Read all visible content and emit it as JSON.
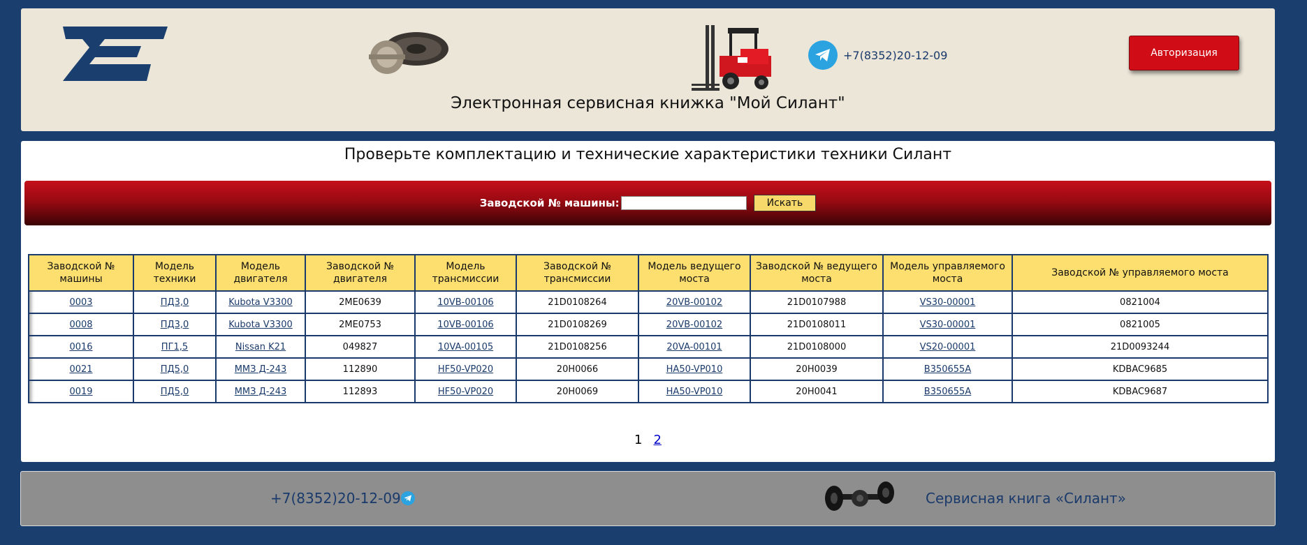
{
  "header": {
    "phone": "+7(8352)20-12-09",
    "auth_label": "Авторизация",
    "title": "Электронная сервисная книжка \"Мой Силант\""
  },
  "main": {
    "title": "Проверьте комплектацию и технические характеристики техники Силант",
    "search_label": "Заводской № машины:",
    "search_value": "",
    "search_button": "Искать"
  },
  "table": {
    "columns": [
      "Заводской № машины",
      "Модель техники",
      "Модель двигателя",
      "Заводской № двигателя",
      "Модель трансмиссии",
      "Заводской № трансмиссии",
      "Модель ведущего моста",
      "Заводской № ведущего моста",
      "Модель управляемого моста",
      "Заводской № управляемого моста"
    ],
    "rows": [
      [
        "0003",
        "ПД3,0",
        "Kubota V3300",
        "2ME0639",
        "10VB-00106",
        "21D0108264",
        "20VB-00102",
        "21D0107988",
        "VS30-00001",
        "0821004"
      ],
      [
        "0008",
        "ПД3,0",
        "Kubota V3300",
        "2ME0753",
        "10VB-00106",
        "21D0108269",
        "20VB-00102",
        "21D0108011",
        "VS30-00001",
        "0821005"
      ],
      [
        "0016",
        "ПГ1,5",
        "Nissan K21",
        "049827",
        "10VA-00105",
        "21D0108256",
        "20VA-00101",
        "21D0108000",
        "VS20-00001",
        "21D0093244"
      ],
      [
        "0021",
        "ПД5,0",
        "ММЗ Д-243",
        "112890",
        "HF50-VP020",
        "20H0066",
        "HA50-VP010",
        "20H0039",
        "B350655A",
        "KDBAC9685"
      ],
      [
        "0019",
        "ПД5,0",
        "ММЗ Д-243",
        "112893",
        "HF50-VP020",
        "20H0069",
        "HA50-VP010",
        "20H0041",
        "B350655A",
        "KDBAC9687"
      ]
    ]
  },
  "pagination": {
    "current": "1",
    "next": "2"
  },
  "footer": {
    "phone": "+7(8352)20-12-09",
    "title": "Сервисная книга «Силант»"
  },
  "colors": {
    "page_bg": "#1a3f6f",
    "header_bg": "#ebe6d8",
    "accent_red": "#d00c16",
    "table_header": "#fddf6f",
    "border_blue": "#1a3a6b",
    "footer_bg": "#8e8e8e",
    "telegram": "#2aa3e0"
  },
  "icons": [
    "silant-logo",
    "gears-image",
    "forklift-image",
    "telegram-icon",
    "axle-image"
  ]
}
